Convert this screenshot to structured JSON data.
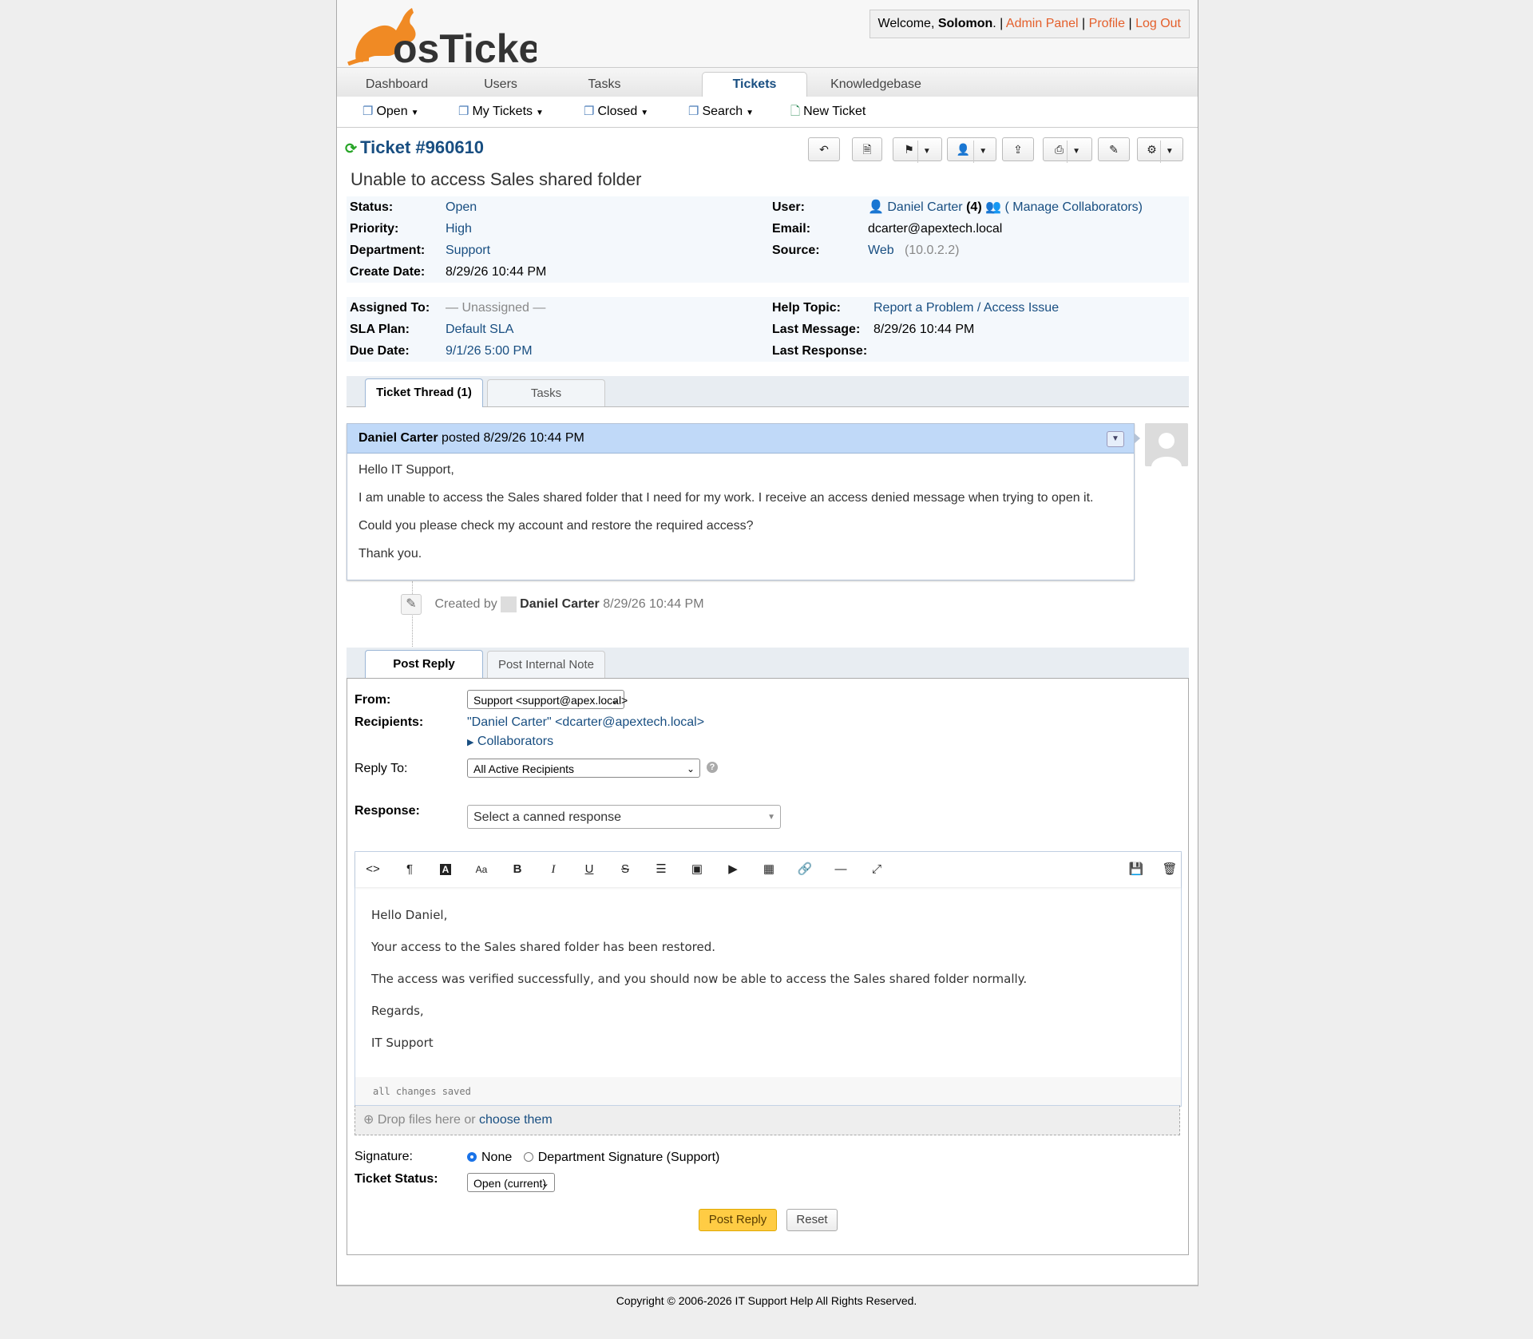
{
  "header": {
    "welcome_prefix": "Welcome,",
    "user_name": "Solomon",
    "admin_panel": "Admin Panel",
    "profile": "Profile",
    "logout": "Log Out",
    "logo_text": "osTicket"
  },
  "nav": {
    "tabs": [
      "Dashboard",
      "Users",
      "Tasks",
      "Tickets",
      "Knowledgebase"
    ],
    "active": "Tickets"
  },
  "subnav": {
    "open": "Open",
    "my_tickets": "My Tickets",
    "closed": "Closed",
    "search": "Search",
    "new_ticket": "New Ticket"
  },
  "ticket": {
    "number": "Ticket #960610",
    "subject": "Unable to access Sales shared folder",
    "status_label": "Status:",
    "status": "Open",
    "priority_label": "Priority:",
    "priority": "High",
    "department_label": "Department:",
    "department": "Support",
    "create_date_label": "Create Date:",
    "create_date": "8/29/26 10:44 PM",
    "user_label": "User:",
    "user": "Daniel Carter",
    "user_count": "(4)",
    "manage_collaborators": "( Manage Collaborators)",
    "email_label": "Email:",
    "email": "dcarter@apextech.local",
    "source_label": "Source:",
    "source": "Web",
    "source_ip": "(10.0.2.2)",
    "assigned_label": "Assigned To:",
    "assigned": "— Unassigned —",
    "sla_label": "SLA Plan:",
    "sla": "Default SLA",
    "due_label": "Due Date:",
    "due": "9/1/26 5:00 PM",
    "help_topic_label": "Help Topic:",
    "help_topic": "Report a Problem / Access Issue",
    "last_message_label": "Last Message:",
    "last_message": "8/29/26 10:44 PM",
    "last_response_label": "Last Response:",
    "last_response": ""
  },
  "thread_tabs": {
    "thread": "Ticket Thread (1)",
    "tasks": "Tasks"
  },
  "message": {
    "author": "Daniel Carter",
    "posted": "posted 8/29/26 10:44 PM",
    "lines": [
      "Hello IT Support,",
      "I am unable to access the Sales shared folder that I need for my work. I receive an access denied message when trying to open it.",
      "Could you please check my account and restore the required access?",
      "Thank you."
    ]
  },
  "event": {
    "created_by": "Created by",
    "author": "Daniel Carter",
    "time": "8/29/26 10:44 PM"
  },
  "reply_tabs": {
    "post_reply": "Post Reply",
    "internal_note": "Post Internal Note"
  },
  "reply": {
    "from_label": "From:",
    "from_value": "Support <support@apex.local>",
    "recipients_label": "Recipients:",
    "recipients_value": "\"Daniel Carter\" <dcarter@apextech.local>",
    "collaborators": "Collaborators",
    "reply_to_label": "Reply To:",
    "reply_to_value": "All Active Recipients",
    "response_label": "Response:",
    "response_placeholder": "Select a canned response",
    "editor_lines": [
      "Hello Daniel,",
      "Your access to the Sales shared folder has been restored.",
      "The access was verified successfully, and you should now be able to access the Sales shared folder normally.",
      "Regards,",
      "IT Support"
    ],
    "saved_status": "all changes saved",
    "drop_text": "Drop files here or",
    "choose_them": "choose them",
    "signature_label": "Signature:",
    "sig_none": "None",
    "sig_dept": "Department Signature (Support)",
    "ticket_status_label": "Ticket Status:",
    "ticket_status_value": "Open (current)",
    "post_reply_btn": "Post Reply",
    "reset_btn": "Reset"
  },
  "footer": "Copyright © 2006-2026 IT Support Help All Rights Reserved.",
  "colors": {
    "brand_orange": "#E45F2B",
    "link_blue": "#184e81",
    "post_button": "#ffcc44"
  }
}
